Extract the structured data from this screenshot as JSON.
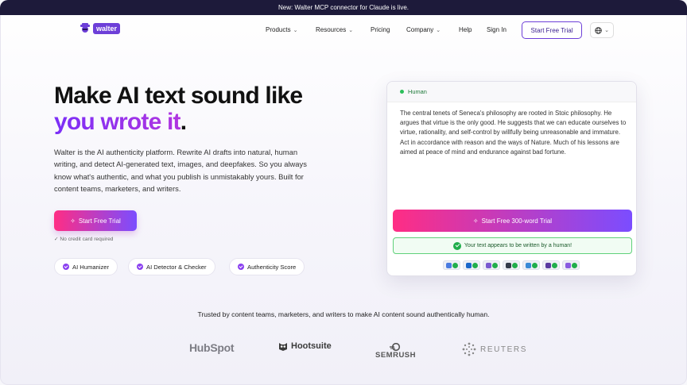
{
  "banner": {
    "text": "New: Walter MCP connector for Claude is live."
  },
  "brand": {
    "name": "walter",
    "accent": "#6d3fd8"
  },
  "nav": {
    "items": [
      {
        "label": "Products",
        "has_menu": true
      },
      {
        "label": "Resources",
        "has_menu": true
      },
      {
        "label": "Pricing",
        "has_menu": false
      },
      {
        "label": "Company",
        "has_menu": true
      },
      {
        "label": "Help",
        "has_menu": false
      },
      {
        "label": "Sign In",
        "has_menu": false
      }
    ],
    "cta_label": "Start Free Trial",
    "language_icon": "globe-icon"
  },
  "hero": {
    "headline_line1": "Make AI text sound like",
    "headline_line2": "you wrote it",
    "headline_period": ".",
    "lead": "Walter is the AI authenticity platform. Rewrite AI drafts into natural, human writing, and detect AI-generated text, images, and deepfakes. So you always know what's authentic, and what you publish is unmistakably yours. Built for content teams, marketers, and writers.",
    "cta_label": "Start Free Trial",
    "note": "No credit card required",
    "pills": [
      "AI Humanizer",
      "AI Detector & Checker",
      "Authenticity Score"
    ]
  },
  "demo_card": {
    "status_label": "Human",
    "text": "The central tenets of Seneca's philosophy are rooted in Stoic philosophy. He argues that virtue is the only good. He suggests that we can educate ourselves to virtue, rationality, and self-control by willfully being unreasonable and immature. Act in accordance with reason and the ways of Nature. Much of his lessons are aimed at peace of mind and endurance against bad fortune.",
    "cta_label": "Start Free 300-word Trial",
    "verdict": "Your text appears to be written by a human!",
    "detectors": [
      {
        "icon": "detector-1-icon",
        "color": "#4a7be0"
      },
      {
        "icon": "detector-2-icon",
        "color": "#1a66c9"
      },
      {
        "icon": "detector-3-icon",
        "color": "#7a5ad0"
      },
      {
        "icon": "detector-4-icon",
        "color": "#333a4a"
      },
      {
        "icon": "detector-5-icon",
        "color": "#3a8ad6"
      },
      {
        "icon": "detector-6-icon",
        "color": "#5a3aa0"
      },
      {
        "icon": "detector-7-icon",
        "color": "#8a5ce0"
      }
    ]
  },
  "trust": {
    "text": "Trusted by content teams, marketers, and writers to make AI content sound authentically human.",
    "logos": [
      "HubSpot",
      "Hootsuite",
      "SEMRUSH",
      "REUTERS"
    ]
  }
}
